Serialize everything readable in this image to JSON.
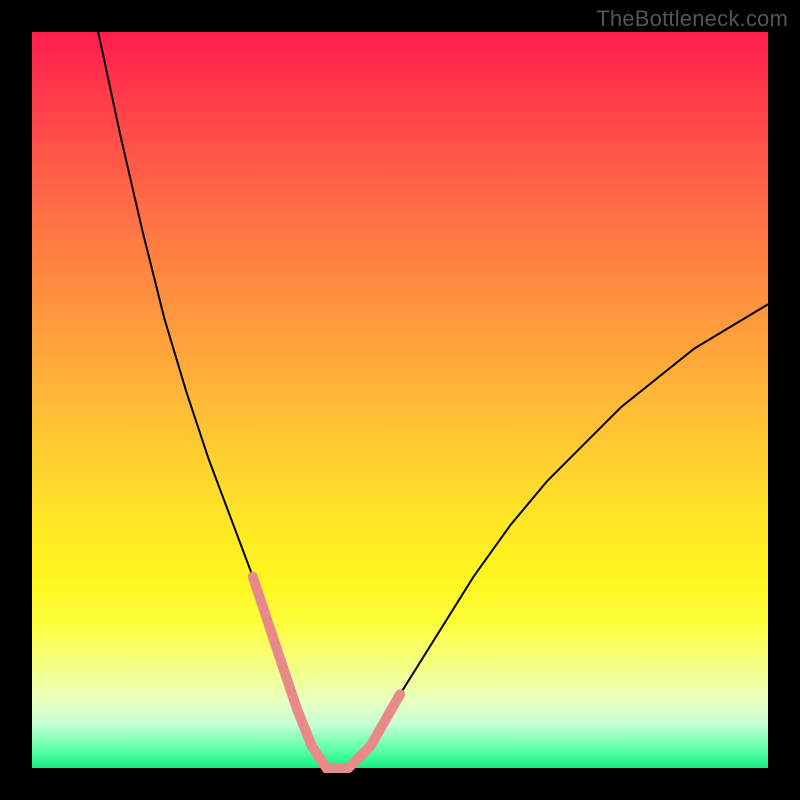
{
  "watermark": {
    "text": "TheBottleneck.com"
  },
  "chart_data": {
    "type": "line",
    "title": "",
    "xlabel": "",
    "ylabel": "",
    "xlim": [
      0,
      100
    ],
    "ylim": [
      0,
      100
    ],
    "grid": false,
    "legend": false,
    "background": {
      "type": "vertical_gradient",
      "stops": [
        {
          "pos": 0,
          "color": "#ff1d4e"
        },
        {
          "pos": 50,
          "color": "#ffc233"
        },
        {
          "pos": 80,
          "color": "#fbff3e"
        },
        {
          "pos": 100,
          "color": "#15ef80"
        }
      ]
    },
    "series": [
      {
        "name": "curve",
        "color": "#000000",
        "width": 2,
        "x": [
          9,
          12,
          15,
          18,
          21,
          24,
          27,
          30,
          32,
          34,
          36,
          38,
          40,
          43,
          46,
          50,
          55,
          60,
          65,
          70,
          75,
          80,
          85,
          90,
          95,
          100
        ],
        "y": [
          100,
          86,
          73,
          61,
          51,
          42,
          34,
          26,
          20,
          14,
          8,
          3,
          0,
          0,
          3,
          10,
          18,
          26,
          33,
          39,
          44,
          49,
          53,
          57,
          60,
          63
        ]
      },
      {
        "name": "highlight-left",
        "color": "#e88a8a",
        "width": 10,
        "linecap": "round",
        "x": [
          30,
          32,
          34,
          36,
          38
        ],
        "y": [
          26,
          20,
          14,
          8,
          3
        ]
      },
      {
        "name": "highlight-bottom",
        "color": "#e88a8a",
        "width": 10,
        "linecap": "round",
        "x": [
          38,
          40,
          43
        ],
        "y": [
          3,
          0,
          0
        ]
      },
      {
        "name": "highlight-right",
        "color": "#e88a8a",
        "width": 10,
        "linecap": "round",
        "x": [
          43,
          46,
          50
        ],
        "y": [
          0,
          3,
          10
        ]
      }
    ]
  }
}
